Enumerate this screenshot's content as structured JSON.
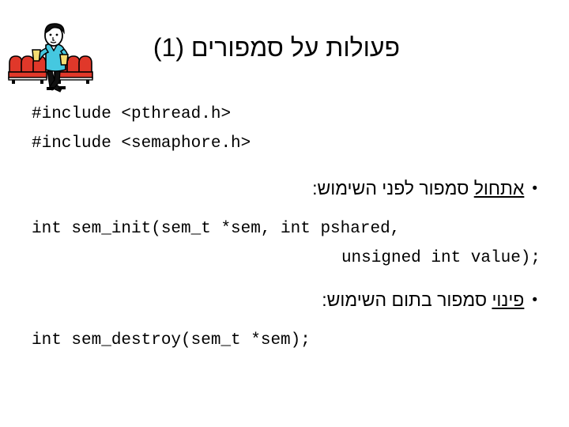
{
  "slide": {
    "title": "פעולות על סמפורים (1)",
    "background_color": "#ffffff",
    "text_color": "#000000"
  },
  "clipart": {
    "name": "theater-usher-with-cinema-seats",
    "alt": "איש מחזיק כוסות לפני כיסאות קולנוע אדומים",
    "colors": {
      "seat": "#e0382a",
      "seat_shadow": "#b72a1e",
      "shirt": "#45c8e0",
      "cup": "#f5dd72",
      "skin": "#ffffff",
      "hair": "#000000",
      "outline": "#000000"
    }
  },
  "content": {
    "includes": [
      "#include <pthread.h>",
      "#include <semaphore.h>"
    ],
    "sections": [
      {
        "bullet_dot": "•",
        "underlined_word": "אתחול",
        "rest_text": " סמפור לפני השימוש:",
        "code_lines": [
          "int sem_init(sem_t *sem, int pshared,",
          "unsigned int value);"
        ]
      },
      {
        "bullet_dot": "•",
        "underlined_word": "פינוי",
        "rest_text": " סמפור בתום השימוש:",
        "code_lines": [
          "int sem_destroy(sem_t *sem);"
        ]
      }
    ]
  }
}
